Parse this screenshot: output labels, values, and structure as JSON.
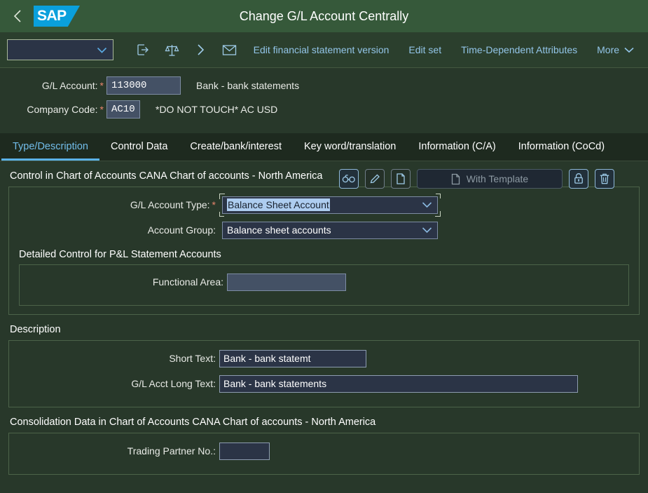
{
  "shell": {
    "back_icon": "chevron-left-icon",
    "logo_text": "SAP",
    "title": "Change G/L Account Centrally"
  },
  "toolbar": {
    "variant_select_value": "",
    "icons": [
      {
        "name": "open-in-new-icon",
        "label": "Open"
      },
      {
        "name": "balance-scale-icon",
        "label": "Comparison"
      },
      {
        "name": "chevron-right-icon",
        "label": "Next"
      },
      {
        "name": "envelope-icon",
        "label": "Mail"
      }
    ],
    "links": [
      "Edit financial statement version",
      "Edit set",
      "Time-Dependent Attributes"
    ],
    "more_label": "More"
  },
  "object_header": {
    "gl_account_label": "G/L Account:",
    "gl_account_value": "113000",
    "gl_account_description": "Bank -  bank statements",
    "company_code_label": "Company Code:",
    "company_code_value": "AC10",
    "company_code_description": "*DO NOT TOUCH* AC USD",
    "required_marker": "*",
    "actions": [
      {
        "name": "display-glasses-icon",
        "label": "Display"
      },
      {
        "name": "edit-pencil-icon",
        "label": "Edit"
      },
      {
        "name": "copy-page-icon",
        "label": "Copy"
      }
    ],
    "with_template_label": "With Template",
    "with_template_icon": "page-icon",
    "lock_icon_label": "Block",
    "delete_icon_label": "Delete"
  },
  "tabs": [
    {
      "label": "Type/Description",
      "active": true
    },
    {
      "label": "Control Data",
      "active": false
    },
    {
      "label": "Create/bank/interest",
      "active": false
    },
    {
      "label": "Key word/translation",
      "active": false
    },
    {
      "label": "Information (C/A)",
      "active": false
    },
    {
      "label": "Information (CoCd)",
      "active": false
    }
  ],
  "sections": {
    "control": {
      "title": "Control in Chart of Accounts CANA Chart of accounts - North America",
      "gl_account_type_label": "G/L Account Type:",
      "gl_account_type_value": "Balance Sheet Account",
      "gl_account_type_required": "*",
      "account_group_label": "Account Group:",
      "account_group_value": "Balance sheet accounts",
      "detailed_control_title": "Detailed Control for P&L Statement Accounts",
      "functional_area_label": "Functional Area:",
      "functional_area_value": ""
    },
    "description": {
      "title": "Description",
      "short_text_label": "Short Text:",
      "short_text_value": "Bank -  bank statemt",
      "long_text_label": "G/L Acct Long Text:",
      "long_text_value": "Bank -  bank statements"
    },
    "consolidation": {
      "title": "Consolidation Data in Chart of Accounts CANA Chart of accounts - North America",
      "trading_partner_label": "Trading Partner No.:",
      "trading_partner_value": ""
    }
  },
  "colors": {
    "shell_header_bg": "#36593a",
    "toolbar_bg": "#2b3f2d",
    "page_bg": "#28382a",
    "tabbar_bg": "#1e2a1f",
    "accent_blue": "#5bb2e8",
    "link_blue": "#93c5e8",
    "sap_logo_blue": "#0aa0dc",
    "required_star": "#e8846b",
    "field_bg": "#2b3446",
    "readonly_field_bg": "#445165",
    "selection_highlight": "#aecdf0",
    "panel_border": "#4c6349"
  }
}
